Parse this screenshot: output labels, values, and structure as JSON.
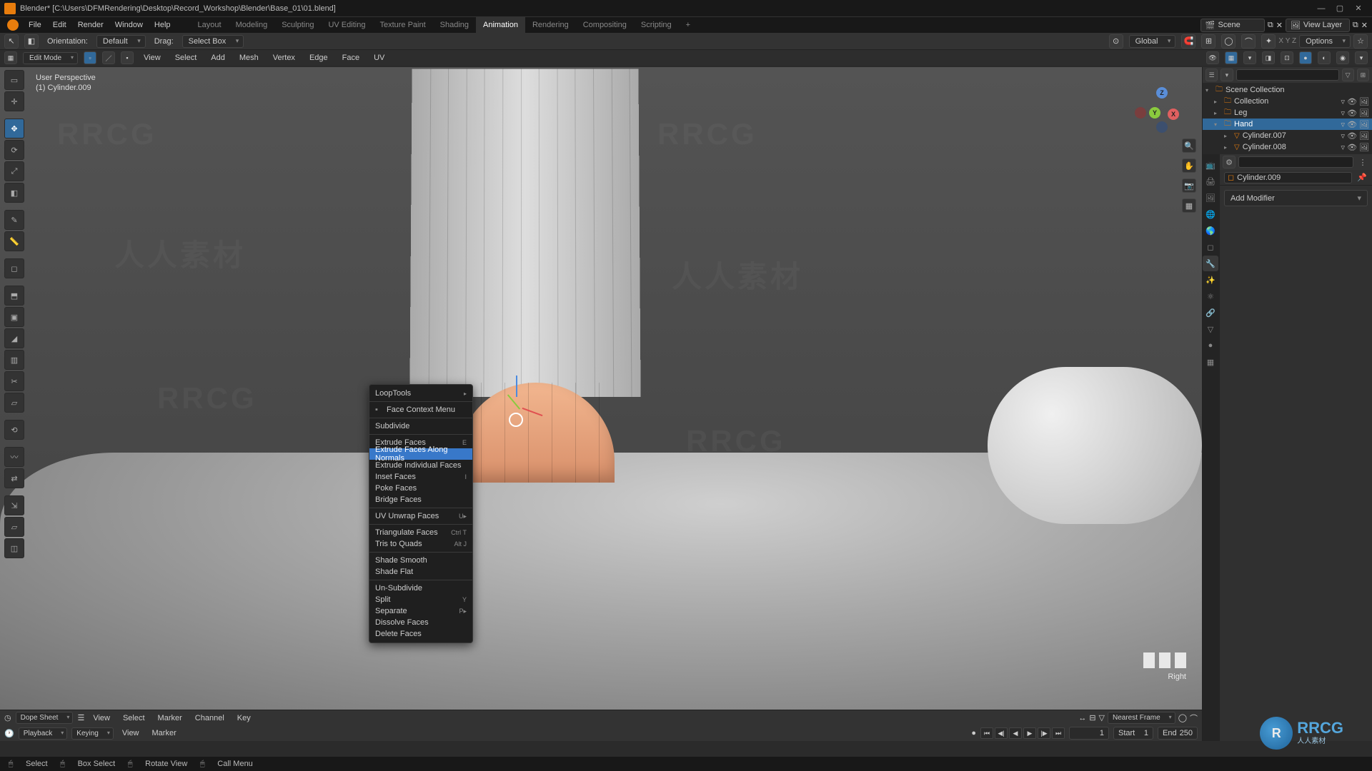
{
  "title": "Blender* [C:\\Users\\DFMRendering\\Desktop\\Record_Workshop\\Blender\\Base_01\\01.blend]",
  "menu": {
    "file": "File",
    "edit": "Edit",
    "render": "Render",
    "window": "Window",
    "help": "Help"
  },
  "tabs": {
    "layout": "Layout",
    "modeling": "Modeling",
    "sculpting": "Sculpting",
    "uv": "UV Editing",
    "texpaint": "Texture Paint",
    "shading": "Shading",
    "animation": "Animation",
    "rendering": "Rendering",
    "compositing": "Compositing",
    "scripting": "Scripting"
  },
  "scene": {
    "label": "Scene",
    "viewlayer": "View Layer"
  },
  "hdr1": {
    "mode_icon": "⊞",
    "orientation": "Orientation:",
    "orient_val": "Default",
    "drag": "Drag:",
    "drag_val": "Select Box",
    "transform": "Global",
    "options": "Options"
  },
  "hdr2": {
    "mode": "Edit Mode",
    "view": "View",
    "select": "Select",
    "add": "Add",
    "mesh": "Mesh",
    "vertex": "Vertex",
    "edge": "Edge",
    "face": "Face",
    "uv": "UV"
  },
  "viewport": {
    "persp": "User Perspective",
    "obj": "(1) Cylinder.009",
    "rightlabel": "Right"
  },
  "ctx": {
    "looptools": "LoopTools",
    "facectx": "Face Context Menu",
    "subdivide": "Subdivide",
    "extrude": "Extrude Faces",
    "extrude_sc": "E",
    "extrude_norm": "Extrude Faces Along Normals",
    "extrude_ind": "Extrude Individual Faces",
    "inset": "Inset Faces",
    "inset_sc": "I",
    "poke": "Poke Faces",
    "bridge": "Bridge Faces",
    "uvunwrap": "UV Unwrap Faces",
    "uvunwrap_sc": "U▸",
    "tri": "Triangulate Faces",
    "tri_sc": "Ctrl T",
    "tris2quads": "Tris to Quads",
    "tris2quads_sc": "Alt J",
    "shadesmooth": "Shade Smooth",
    "shadeflat": "Shade Flat",
    "unsub": "Un-Subdivide",
    "split": "Split",
    "split_sc": "Y",
    "separate": "Separate",
    "separate_sc": "P▸",
    "dissolve": "Dissolve Faces",
    "delete": "Delete Faces"
  },
  "outliner": {
    "scene_coll": "Scene Collection",
    "collection": "Collection",
    "leg": "Leg",
    "hand": "Hand",
    "cyl7": "Cylinder.007",
    "cyl8": "Cylinder.008"
  },
  "props": {
    "crumb": "Cylinder.009",
    "addmod": "Add Modifier"
  },
  "dopesheet": {
    "mode": "Dope Sheet",
    "view": "View",
    "select": "Select",
    "marker": "Marker",
    "channel": "Channel",
    "key": "Key",
    "nearest": "Nearest Frame"
  },
  "tl2": {
    "playback": "Playback",
    "keying": "Keying",
    "view": "View",
    "marker": "Marker",
    "cur": "1",
    "start_l": "Start",
    "start_v": "1",
    "end_l": "End",
    "end_v": "250"
  },
  "status": {
    "select": "Select",
    "boxsel": "Box Select",
    "rotview": "Rotate View",
    "callmenu": "Call Menu"
  },
  "rrcg": {
    "main": "RRCG",
    "sub": "人人素材"
  }
}
